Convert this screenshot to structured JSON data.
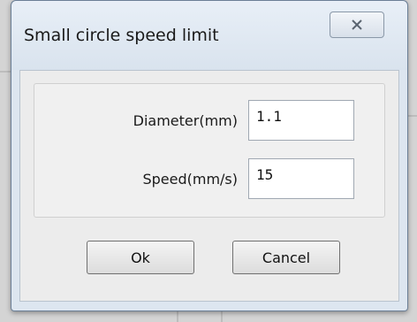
{
  "window": {
    "title": "Small circle speed limit",
    "close_icon": "close-x-icon"
  },
  "form": {
    "diameter_label": "Diameter(mm)",
    "diameter_value": "1.1",
    "speed_label": "Speed(mm/s)",
    "speed_value": "15"
  },
  "buttons": {
    "ok_label": "Ok",
    "cancel_label": "Cancel"
  }
}
